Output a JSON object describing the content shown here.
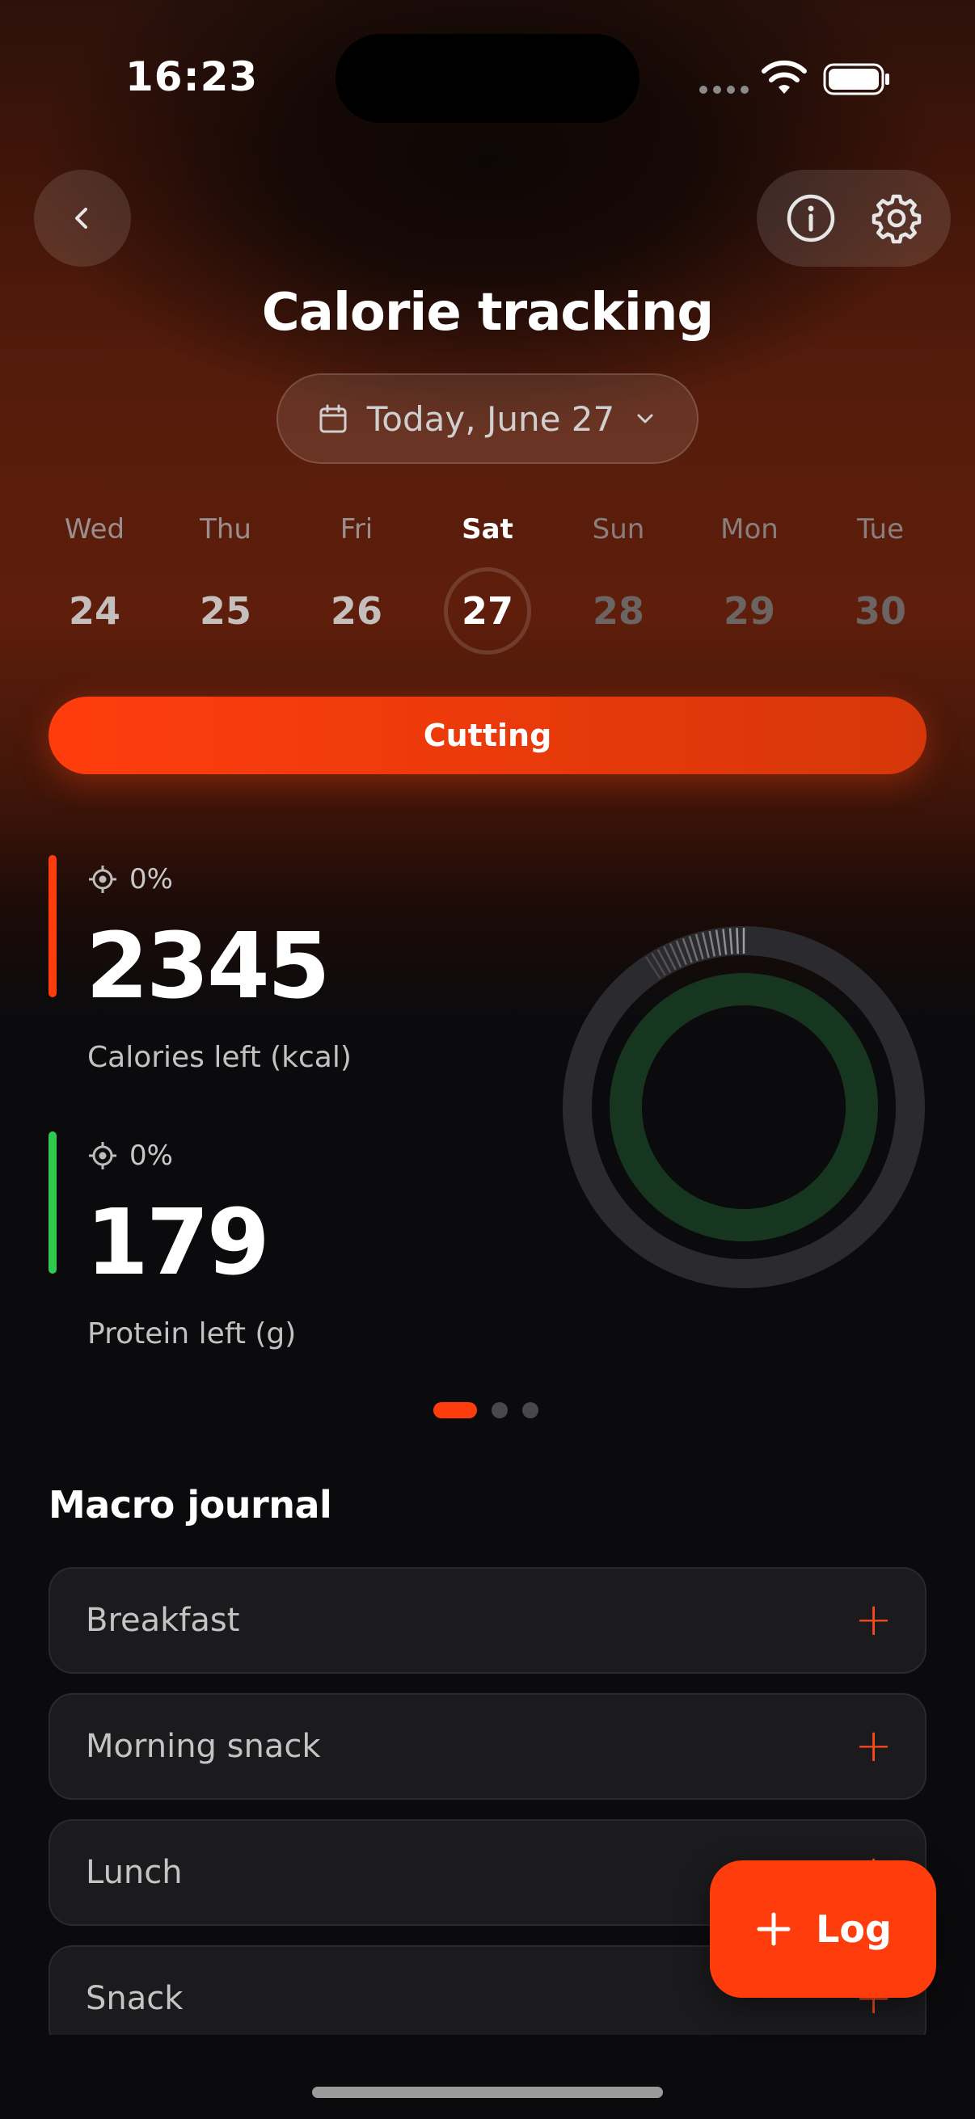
{
  "status_bar": {
    "time": "16:23"
  },
  "header": {
    "title": "Calorie tracking",
    "date_label": "Today, June 27"
  },
  "week": [
    {
      "name": "Wed",
      "num": "24",
      "state": "past"
    },
    {
      "name": "Thu",
      "num": "25",
      "state": "past"
    },
    {
      "name": "Fri",
      "num": "26",
      "state": "past"
    },
    {
      "name": "Sat",
      "num": "27",
      "state": "active"
    },
    {
      "name": "Sun",
      "num": "28",
      "state": "future"
    },
    {
      "name": "Mon",
      "num": "29",
      "state": "future"
    },
    {
      "name": "Tue",
      "num": "30",
      "state": "future"
    }
  ],
  "mode": {
    "label": "Cutting"
  },
  "stats": {
    "calories": {
      "percent": "0%",
      "value": "2345",
      "label": "Calories left (kcal)",
      "color": "#ff3d0c"
    },
    "protein": {
      "percent": "0%",
      "value": "179",
      "label": "Protein left (g)",
      "color": "#2fc94e"
    }
  },
  "pager": {
    "pages": 3,
    "current": 1
  },
  "journal": {
    "title": "Macro journal",
    "meals": [
      {
        "label": "Breakfast"
      },
      {
        "label": "Morning snack"
      },
      {
        "label": "Lunch"
      },
      {
        "label": "Snack"
      }
    ]
  },
  "fab": {
    "label": "Log"
  },
  "icons": {
    "back": "chevron-left-icon",
    "info": "info-icon",
    "settings": "gear-icon",
    "calendar": "calendar-icon",
    "dropdown": "chevron-down-icon",
    "target": "target-icon",
    "add": "plus-icon"
  },
  "colors": {
    "accent": "#ff3d0c",
    "protein": "#2fc94e",
    "background": "#0b0b0d"
  }
}
